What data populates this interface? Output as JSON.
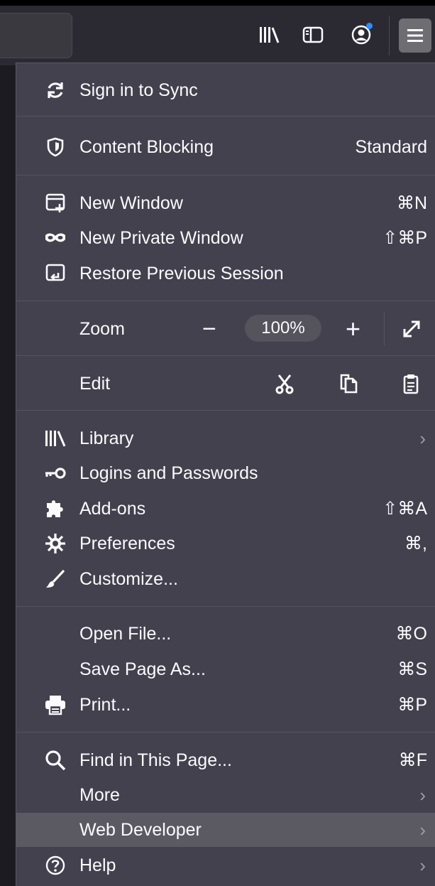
{
  "menu": {
    "sync": {
      "label": "Sign in to Sync"
    },
    "content_blocking": {
      "label": "Content Blocking",
      "value": "Standard"
    },
    "new_window": {
      "label": "New Window",
      "shortcut": "⌘N"
    },
    "new_private_window": {
      "label": "New Private Window",
      "shortcut": "⇧⌘P"
    },
    "restore_session": {
      "label": "Restore Previous Session"
    },
    "zoom": {
      "label": "Zoom",
      "minus": "−",
      "value": "100%",
      "plus": "+"
    },
    "edit": {
      "label": "Edit"
    },
    "library": {
      "label": "Library"
    },
    "logins": {
      "label": "Logins and Passwords"
    },
    "addons": {
      "label": "Add-ons",
      "shortcut": "⇧⌘A"
    },
    "preferences": {
      "label": "Preferences",
      "shortcut": "⌘,"
    },
    "customize": {
      "label": "Customize..."
    },
    "open_file": {
      "label": "Open File...",
      "shortcut": "⌘O"
    },
    "save_page": {
      "label": "Save Page As...",
      "shortcut": "⌘S"
    },
    "print": {
      "label": "Print...",
      "shortcut": "⌘P"
    },
    "find": {
      "label": "Find in This Page...",
      "shortcut": "⌘F"
    },
    "more": {
      "label": "More"
    },
    "web_developer": {
      "label": "Web Developer"
    },
    "help": {
      "label": "Help"
    },
    "chevron": "›"
  },
  "colors": {
    "panel_bg": "#42414d",
    "toolbar_bg": "#2b2a33",
    "highlight_bg": "#5b5a63",
    "notification_dot": "#2d8cff"
  }
}
